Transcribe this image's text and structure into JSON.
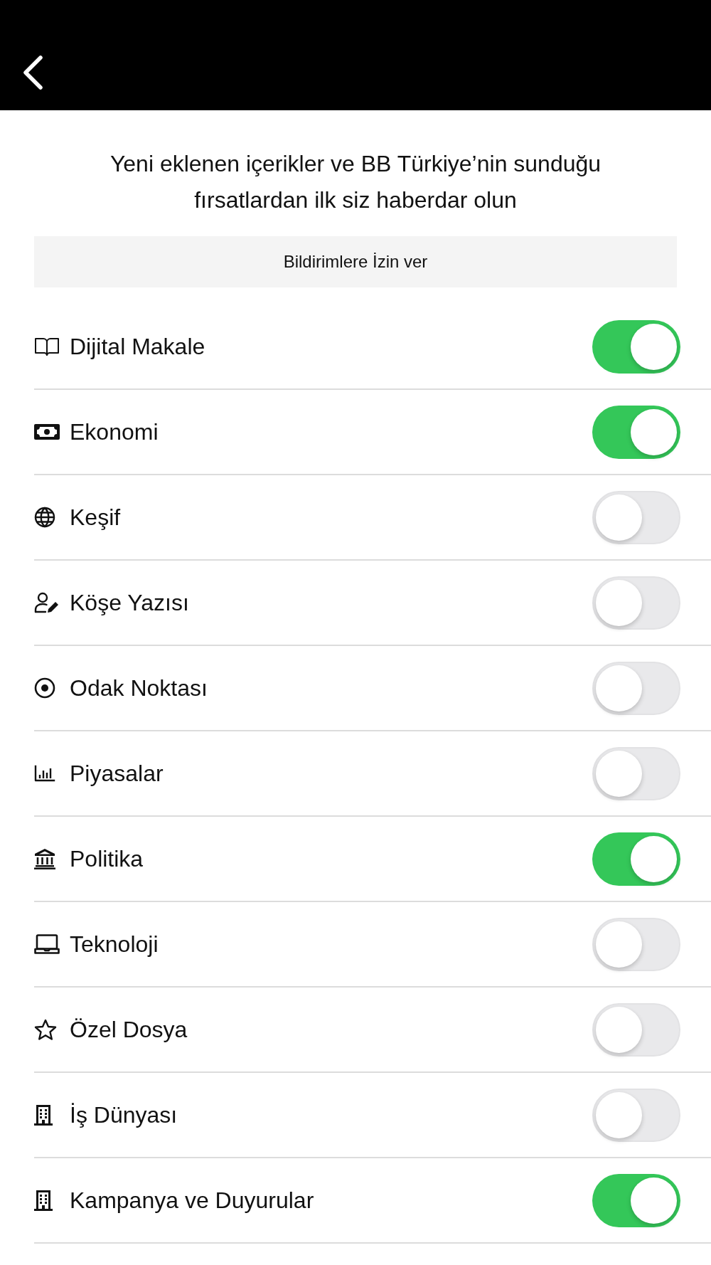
{
  "intro": "Yeni eklenen içerikler ve BB Türkiye’nin sunduğu fırsatlardan ilk siz haberdar olun",
  "allow_button": "Bildirimlere İzin ver",
  "categories": [
    {
      "label": "Dijital Makale",
      "kind": "book",
      "on": true
    },
    {
      "label": "Ekonomi",
      "kind": "banknote",
      "on": true
    },
    {
      "label": "Keşif",
      "kind": "globe",
      "on": false
    },
    {
      "label": "Köşe Yazısı",
      "kind": "writer",
      "on": false
    },
    {
      "label": "Odak Noktası",
      "kind": "focus",
      "on": false
    },
    {
      "label": "Piyasalar",
      "kind": "chart",
      "on": false
    },
    {
      "label": "Politika",
      "kind": "landmark",
      "on": true
    },
    {
      "label": "Teknoloji",
      "kind": "laptop",
      "on": false
    },
    {
      "label": "Özel Dosya",
      "kind": "star",
      "on": false
    },
    {
      "label": "İş Dünyası",
      "kind": "building",
      "on": false
    },
    {
      "label": "Kampanya ve Duyurular",
      "kind": "building",
      "on": true
    }
  ]
}
